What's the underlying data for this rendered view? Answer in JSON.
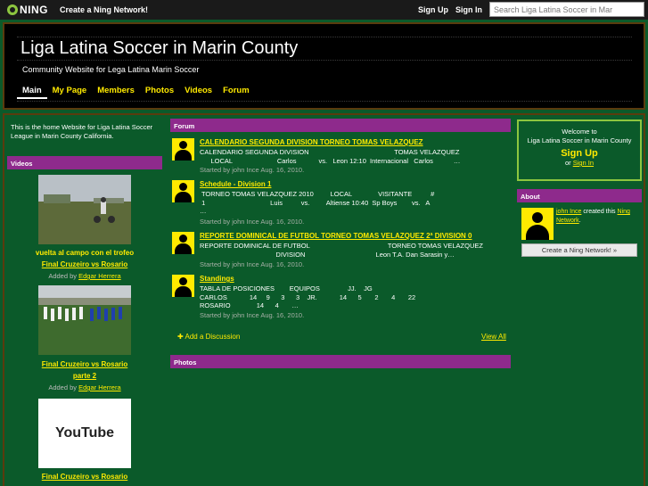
{
  "topbar": {
    "logo": "NING",
    "create_network": "Create a Ning Network!",
    "sign_up": "Sign Up",
    "sign_in": "Sign In",
    "search_value": "Search Liga Latina Soccer in Mar"
  },
  "header": {
    "title": "Liga Latina Soccer in Marin County",
    "subtitle": "Community Website for Lega Latina Marin Soccer",
    "nav": [
      "Main",
      "My Page",
      "Members",
      "Photos",
      "Videos",
      "Forum"
    ]
  },
  "left": {
    "intro": "This is the home Website for Liga Latina Soccer League in Marin County California.",
    "videos_heading": "Videos",
    "videos": [
      {
        "caption": "vuelta al campo con el trofeo",
        "title": "Final Cruzeiro vs Rosario",
        "added_by_label": "Added by",
        "author": "Edgar Herrera"
      },
      {
        "title_line1": "Final Cruzeiro vs Rosario",
        "title_line2": "parte 2",
        "added_by_label": "Added by",
        "author": "Edgar Herrera"
      },
      {
        "title": "Final Cruzeiro vs Rosario",
        "thumb_text": "YouTube"
      }
    ]
  },
  "forum": {
    "heading": "Forum",
    "discussions": [
      {
        "title": "CALENDARIO SEGUNDA DIVISION TORNEO TOMAS VELAZQUEZ",
        "excerpt": "CALENDARIO SEGUNDA DIVISION                                              TOMAS VELAZQUEZ\n      LOCAL                        Carlos            vs.   Leon 12:10  Internacional   Carlos           …",
        "meta": "Started by john Ince Aug. 16, 2010."
      },
      {
        "title": "Schedule - Division 1",
        "excerpt": " TORNEO TOMAS VELAZQUEZ 2010         LOCAL              VISITANTE          #\n 1                                   Luis          vs.         Altiense 10:40  Sp Boys        vs.   A\n…",
        "meta": "Started by john Ince Aug. 16, 2010."
      },
      {
        "title": "REPORTE DOMINICAL DE FUTBOL TORNEO TOMAS VELAZQUEZ 2ª DIVISION 0",
        "excerpt": "REPORTE DOMINICAL DE FUTBOL                                          TORNEO TOMAS VELAZQUEZ\n                                         DIVISION                                      Leon T.A. Dan Sarasin y…",
        "meta": "Started by john Ince Aug. 16, 2010."
      },
      {
        "title": "Standings",
        "excerpt": "TABLA DE POSICIONES        EQUIPOS               JJ.    JG\nCARLOS            14     9      3      3    JR.            14      5       2       4       22\nROSARIO              14      4       …",
        "meta": "Started by john Ince Aug. 16, 2010."
      }
    ],
    "add_discussion": "Add a Discussion",
    "view_all": "View All"
  },
  "photos": {
    "heading": "Photos"
  },
  "right": {
    "welcome_to": "Welcome to",
    "network_name": "Liga Latina Soccer in Marin County",
    "sign_up": "Sign Up",
    "or": "or",
    "sign_in": "Sign In",
    "about_heading": "About",
    "about_creator": "john Ince",
    "about_created_text": "created this",
    "about_network_link": "Ning Network",
    "create_button": "Create a Ning Network! »"
  },
  "colors": {
    "background": "#0b5a2a",
    "accent": "#ffea00",
    "module_header": "#8e2a8c",
    "frame_border": "#5a3b0e"
  }
}
